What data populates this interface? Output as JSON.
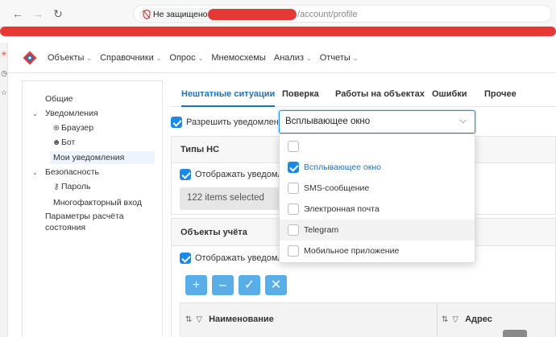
{
  "browser": {
    "insecure_label": "Не защищено",
    "url_path": "/account/profile"
  },
  "nav": {
    "items": [
      {
        "label": "Объекты",
        "has_caret": true
      },
      {
        "label": "Справочники",
        "has_caret": true
      },
      {
        "label": "Опрос",
        "has_caret": true
      },
      {
        "label": "Мнемосхемы",
        "has_caret": false
      },
      {
        "label": "Анализ",
        "has_caret": true
      },
      {
        "label": "Отчеты",
        "has_caret": true
      }
    ]
  },
  "sidebar": {
    "general": "Общие",
    "notifications": "Уведомления",
    "browser": "Браузер",
    "bot": "Бот",
    "my_notifications": "Мои уведомления",
    "security": "Безопасность",
    "password": "Пароль",
    "mfa": "Многофакторный вход",
    "calc_params": "Параметры расчёта",
    "calc_params_2": "состояния"
  },
  "tabs": [
    {
      "label": "Нештатные ситуации",
      "active": true
    },
    {
      "label": "Поверка",
      "active": false
    },
    {
      "label": "Работы на объектах",
      "active": false
    },
    {
      "label": "Ошибки",
      "active": false
    },
    {
      "label": "Прочее",
      "active": false
    }
  ],
  "allow": {
    "label": "Разрешить уведомления",
    "checked": true
  },
  "select": {
    "value": "Всплывающее окно"
  },
  "types_card": {
    "title": "Типы НС",
    "show_label": "Отображать уведомлен",
    "selected_count": "122 items selected"
  },
  "objects_card": {
    "title": "Объекты учёта",
    "show_label": "Отображать уведомлен",
    "buttons": [
      "+",
      "–",
      "✓",
      "✕"
    ],
    "columns": [
      "Наименование",
      "Адрес"
    ]
  },
  "dropdown": {
    "options": [
      {
        "label": "",
        "checked": false,
        "selected": false,
        "hover": false
      },
      {
        "label": "Всплывающее окно",
        "checked": true,
        "selected": true,
        "hover": false
      },
      {
        "label": "SMS-сообщение",
        "checked": false,
        "selected": false,
        "hover": false
      },
      {
        "label": "Электронная почта",
        "checked": false,
        "selected": false,
        "hover": false
      },
      {
        "label": "Telegram",
        "checked": false,
        "selected": false,
        "hover": true
      },
      {
        "label": "Мобильное приложение",
        "checked": false,
        "selected": false,
        "hover": false
      }
    ]
  },
  "colors": {
    "accent": "#1e73be",
    "checkbox": "#1e88e5",
    "toolbar_button": "#5aaee8",
    "redaction": "#e53935"
  },
  "icons": {
    "back": "arrow-left-icon",
    "forward": "arrow-right-icon",
    "reload": "reload-icon",
    "insecure": "shield-slash-icon",
    "logo": "app-logo-icon",
    "browser": "globe-icon",
    "bot": "robot-icon",
    "password": "key-icon",
    "sort": "sort-icon",
    "filter": "filter-icon"
  }
}
